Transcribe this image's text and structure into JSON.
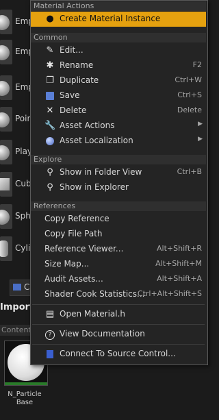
{
  "background": {
    "items": [
      {
        "label": "Emp",
        "shape": "sphere"
      },
      {
        "label": "Emp",
        "shape": "sphere"
      },
      {
        "label": "Emp",
        "shape": "sphere"
      },
      {
        "label": "Poin",
        "shape": "sphere"
      },
      {
        "label": "Play",
        "shape": "sphere"
      },
      {
        "label": "Cub",
        "shape": "cube"
      },
      {
        "label": "Sphe",
        "shape": "sphere"
      },
      {
        "label": "Cylin",
        "shape": "cylinder"
      }
    ],
    "tab_label": "C",
    "import_label": "Import",
    "content_label": "Content",
    "asset_name_line1": "N_Particle",
    "asset_name_line2": "Base"
  },
  "menu": {
    "section_material": "Material Actions",
    "create_material_instance": "Create Material Instance",
    "section_common": "Common",
    "edit": "Edit...",
    "rename": "Rename",
    "rename_shortcut": "F2",
    "duplicate": "Duplicate",
    "duplicate_shortcut": "Ctrl+W",
    "save": "Save",
    "save_shortcut": "Ctrl+S",
    "delete": "Delete",
    "delete_shortcut": "Delete",
    "asset_actions": "Asset Actions",
    "asset_localization": "Asset Localization",
    "section_explore": "Explore",
    "show_in_folder_view": "Show in Folder View",
    "show_in_folder_view_shortcut": "Ctrl+B",
    "show_in_explorer": "Show in Explorer",
    "section_references": "References",
    "copy_reference": "Copy Reference",
    "copy_file_path": "Copy File Path",
    "reference_viewer": "Reference Viewer...",
    "reference_viewer_shortcut": "Alt+Shift+R",
    "size_map": "Size Map...",
    "size_map_shortcut": "Alt+Shift+M",
    "audit_assets": "Audit Assets...",
    "audit_assets_shortcut": "Alt+Shift+A",
    "shader_cook_statistics": "Shader Cook Statistics...",
    "shader_cook_statistics_shortcut": "Ctrl+Alt+Shift+S",
    "open_material_h": "Open Material.h",
    "view_documentation": "View Documentation",
    "connect_to_source_control": "Connect To Source Control..."
  },
  "colors": {
    "highlight": "#e5a10f",
    "menu_bg": "#242424",
    "accent_blue": "#4a6fc7"
  }
}
